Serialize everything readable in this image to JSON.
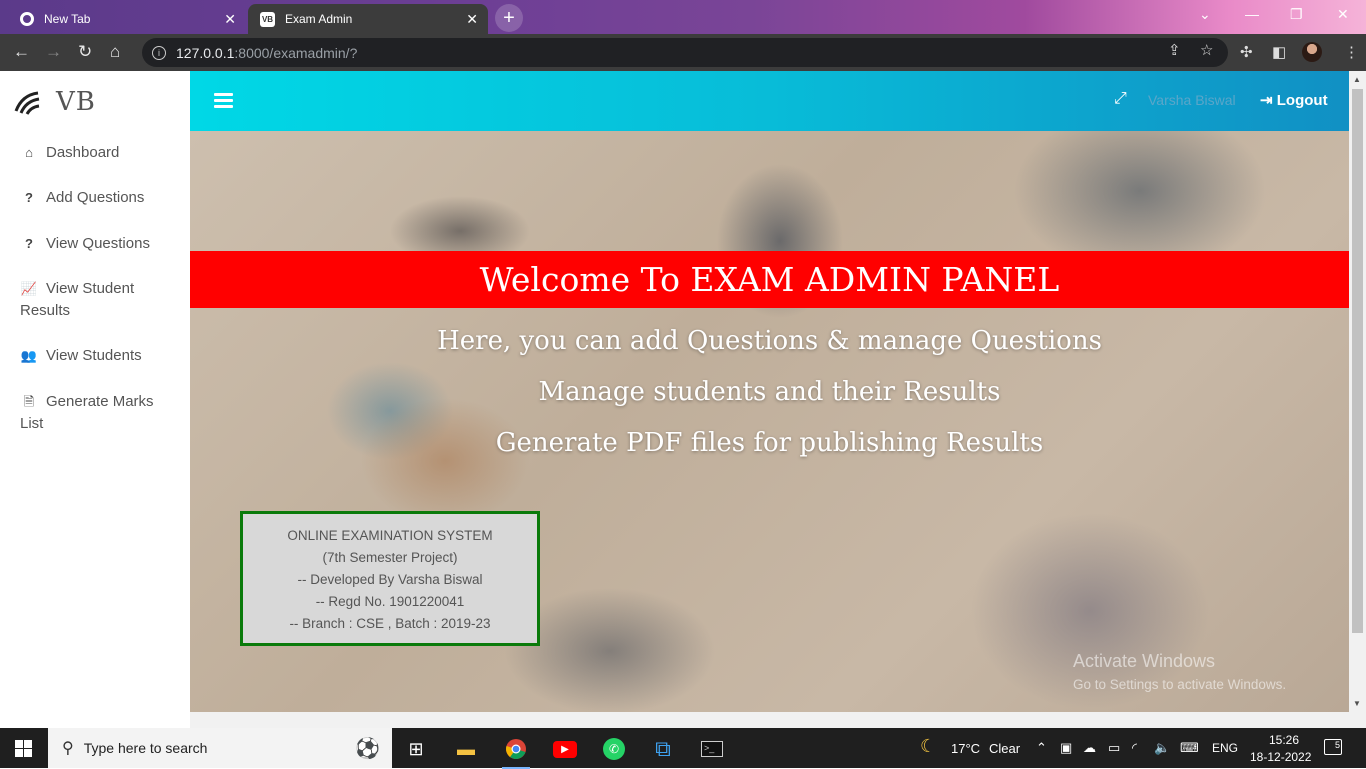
{
  "browser": {
    "tabs": [
      {
        "title": "New Tab",
        "favicon": "chrome-icon"
      },
      {
        "title": "Exam Admin",
        "favicon": "vb-favicon"
      }
    ],
    "url_host": "127.0.0.1",
    "url_rest": ":8000/examadmin/?"
  },
  "sidebar": {
    "brand": "VB",
    "items": [
      {
        "label": "Dashboard",
        "icon": "home-icon"
      },
      {
        "label": "Add Questions",
        "icon": "question-icon"
      },
      {
        "label": "View Questions",
        "icon": "question-icon"
      },
      {
        "label": "View Student Results",
        "icon": "line-chart-icon"
      },
      {
        "label": "View Students",
        "icon": "users-icon"
      },
      {
        "label": "Generate Marks List",
        "icon": "pdf-file-icon"
      }
    ]
  },
  "header": {
    "username": "Varsha Biswal",
    "logout_label": "Logout"
  },
  "hero": {
    "banner": "Welcome To EXAM ADMIN PANEL",
    "lines": [
      "Here, you can add Questions & manage Questions",
      "Manage students and their Results",
      "Generate PDF files for publishing Results"
    ]
  },
  "infobox": {
    "lines": [
      "ONLINE EXAMINATION SYSTEM",
      "(7th Semester Project)",
      "-- Developed By Varsha Biswal",
      "-- Regd No. 1901220041",
      "-- Branch : CSE , Batch : 2019-23"
    ]
  },
  "watermark": {
    "title": "Activate Windows",
    "subtitle": "Go to Settings to activate Windows."
  },
  "taskbar": {
    "search_placeholder": "Type here to search",
    "weather_temp": "17°C",
    "weather_desc": "Clear",
    "language": "ENG",
    "time": "15:26",
    "date": "18-12-2022",
    "notification_count": "5"
  },
  "colors": {
    "header_gradient_start": "#00d8e6",
    "header_gradient_end": "#1190c4",
    "banner": "#ff0000",
    "infobox_border": "#0a7a0a"
  }
}
